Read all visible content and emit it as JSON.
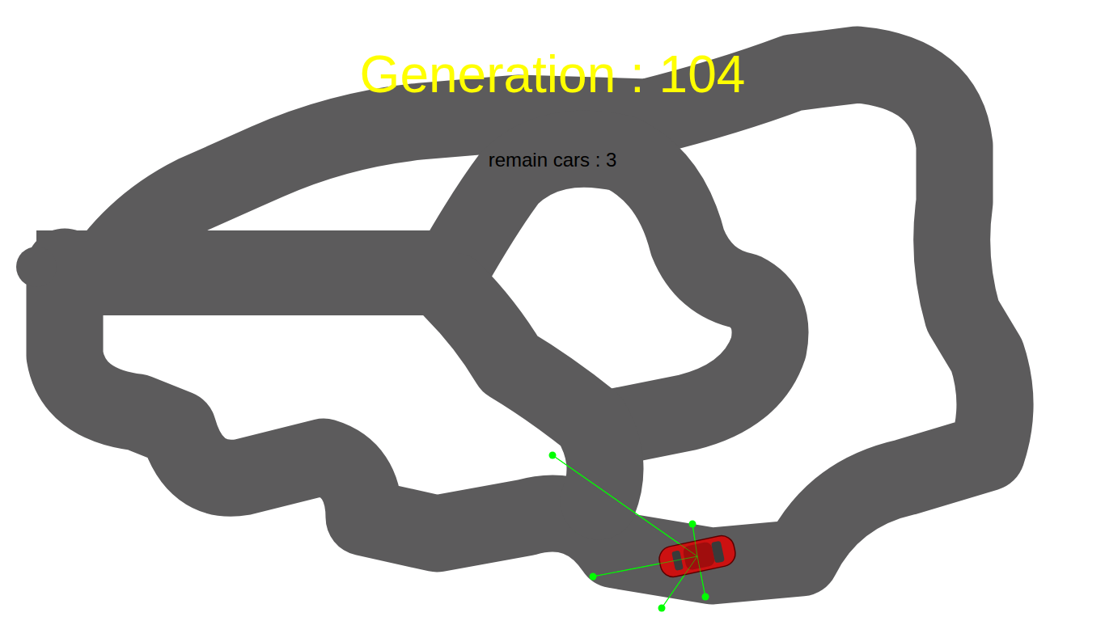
{
  "game": {
    "generation": "Generation : 104",
    "remaining": "remain cars : 3"
  }
}
